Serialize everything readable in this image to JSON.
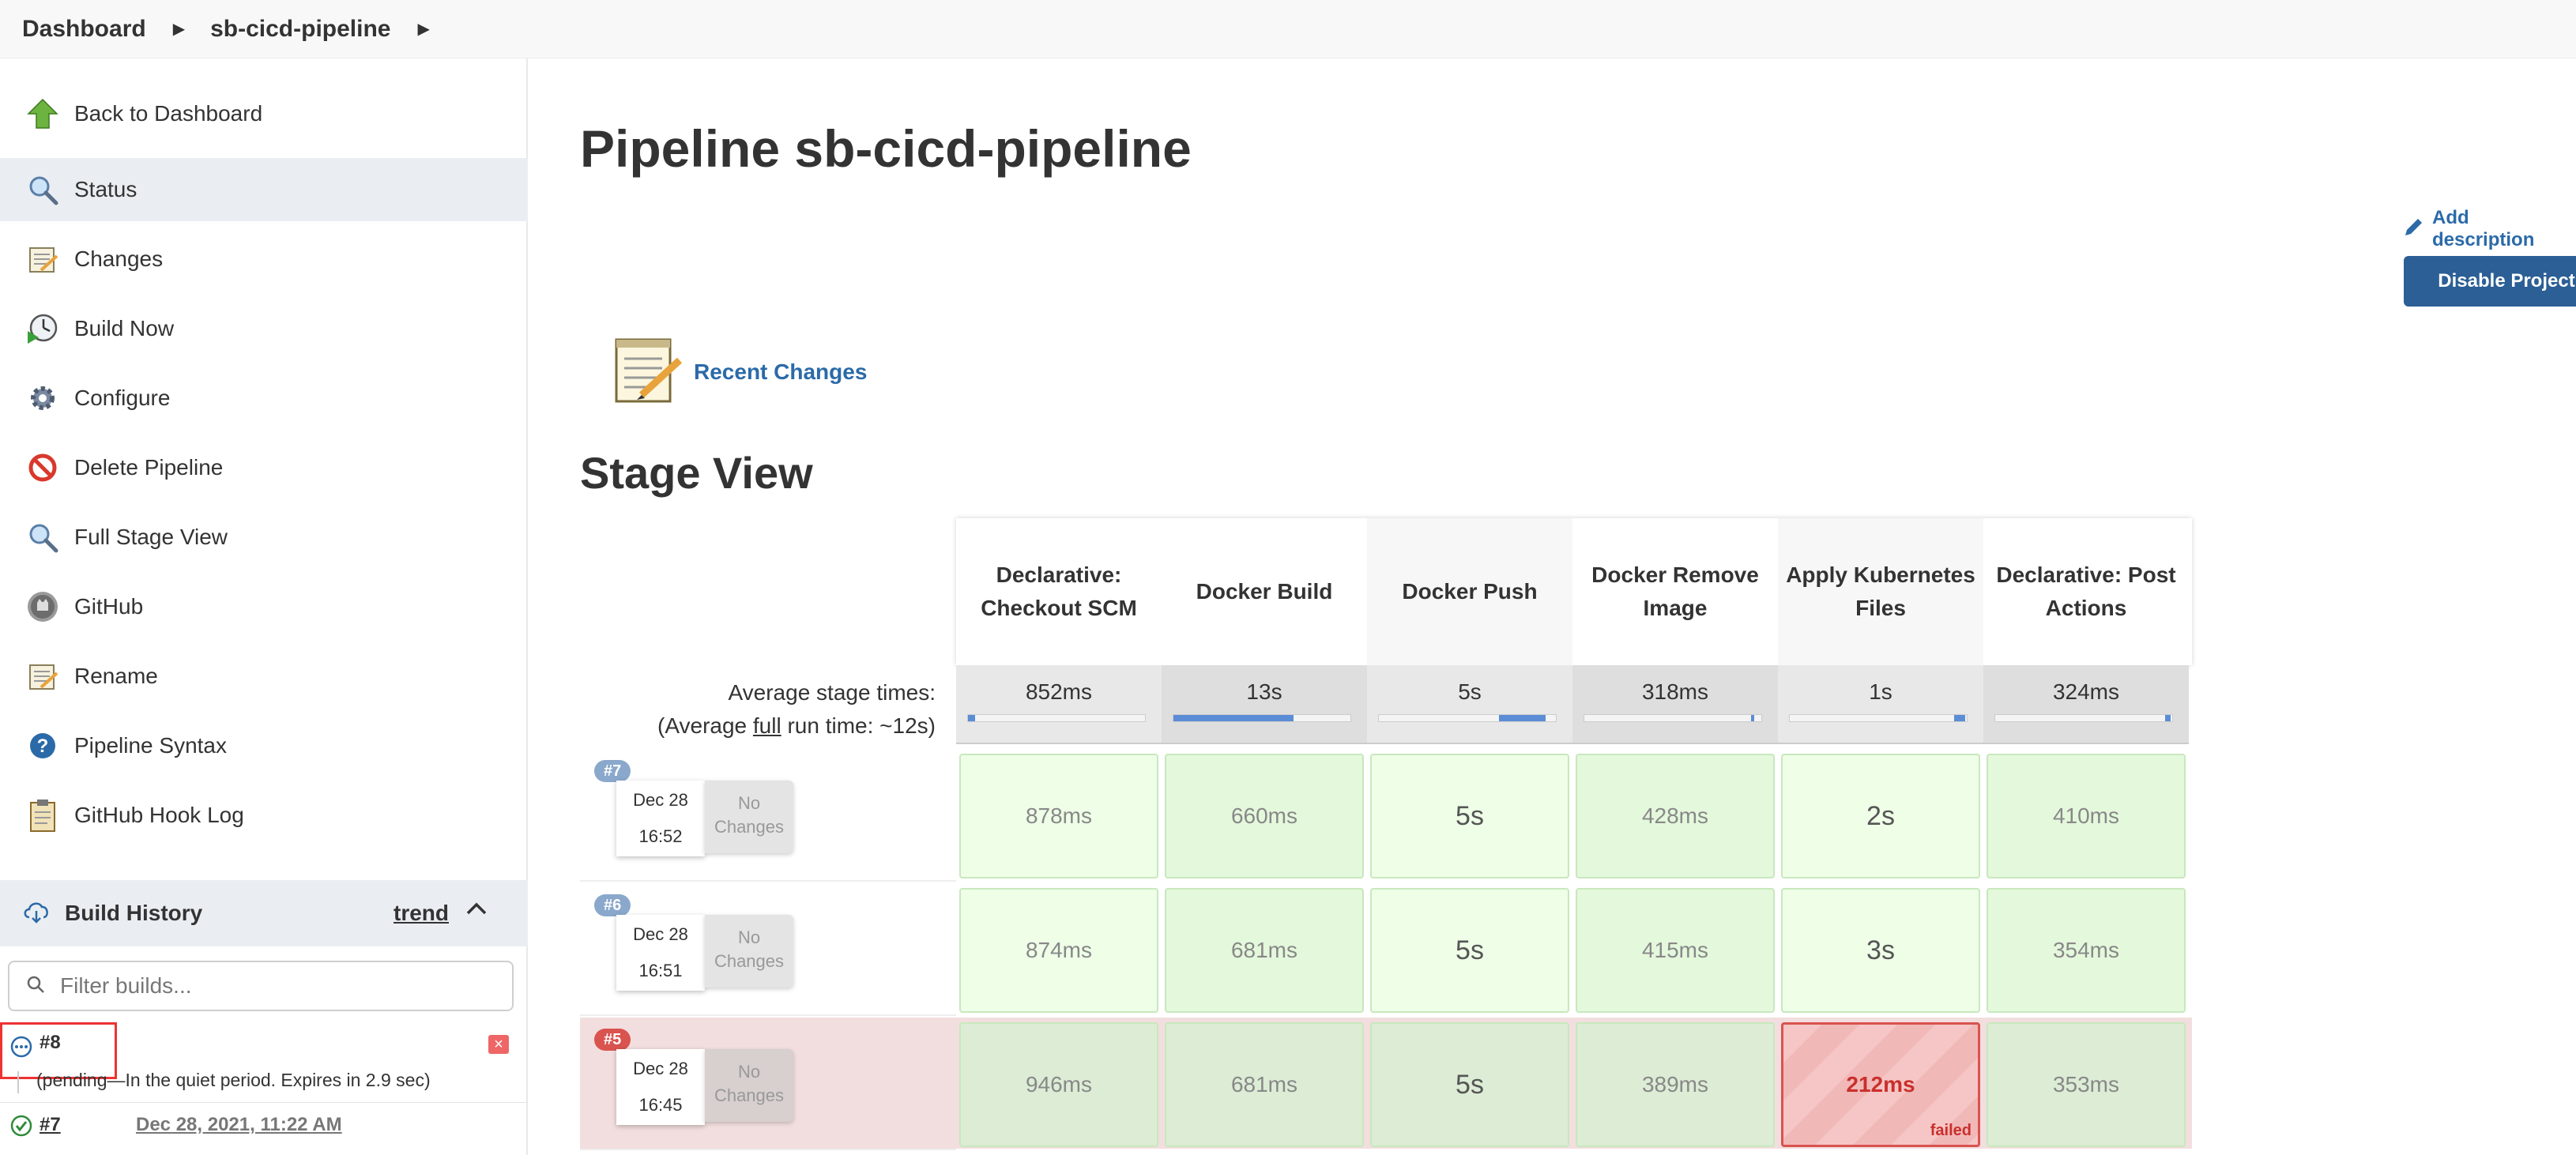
{
  "breadcrumb": {
    "items": [
      "Dashboard",
      "sb-cicd-pipeline"
    ]
  },
  "sidebar": {
    "items": [
      {
        "label": "Back to Dashboard",
        "icon": "up-arrow-icon"
      },
      {
        "label": "Status",
        "icon": "magnifier-icon",
        "active": true
      },
      {
        "label": "Changes",
        "icon": "notepad-icon"
      },
      {
        "label": "Build Now",
        "icon": "clock-play-icon"
      },
      {
        "label": "Configure",
        "icon": "gear-icon"
      },
      {
        "label": "Delete Pipeline",
        "icon": "no-entry-icon"
      },
      {
        "label": "Full Stage View",
        "icon": "magnifier-icon"
      },
      {
        "label": "GitHub",
        "icon": "github-icon"
      },
      {
        "label": "Rename",
        "icon": "notepad-icon"
      },
      {
        "label": "Pipeline Syntax",
        "icon": "help-icon"
      },
      {
        "label": "GitHub Hook Log",
        "icon": "clipboard-icon"
      }
    ],
    "build_history": {
      "title": "Build History",
      "trend": "trend",
      "filter_placeholder": "Filter builds...",
      "builds": [
        {
          "number": "#8",
          "status": "pending",
          "note": "(pending—In the quiet period. Expires in 2.9 sec)"
        },
        {
          "number": "#7",
          "status": "success",
          "date": "Dec 28, 2021, 11:22 AM"
        }
      ]
    }
  },
  "main": {
    "title": "Pipeline sb-cicd-pipeline",
    "add_description": "Add description",
    "disable_button": "Disable Project",
    "recent_changes": "Recent Changes",
    "stage_view_title": "Stage View"
  },
  "stage_view": {
    "avg_label_line1": "Average stage times:",
    "avg_label_prefix": "(Average ",
    "avg_label_link": "full",
    "avg_label_suffix": " run time: ~12s)",
    "stages": [
      {
        "name": "Declarative: Checkout SCM",
        "avg": "852ms",
        "bar_start": 0.0,
        "bar_fill": 0.04
      },
      {
        "name": "Docker Build",
        "avg": "13s",
        "bar_start": 0.0,
        "bar_fill": 0.68
      },
      {
        "name": "Docker Push",
        "avg": "5s",
        "bar_start": 0.68,
        "bar_fill": 0.26
      },
      {
        "name": "Docker Remove Image",
        "avg": "318ms",
        "bar_start": 0.94,
        "bar_fill": 0.02
      },
      {
        "name": "Apply Kubernetes Files",
        "avg": "1s",
        "bar_start": 0.93,
        "bar_fill": 0.06
      },
      {
        "name": "Declarative: Post Actions",
        "avg": "324ms",
        "bar_start": 0.96,
        "bar_fill": 0.03
      }
    ],
    "builds": [
      {
        "badge": "#7",
        "date": "Dec 28",
        "time": "16:52",
        "changes": "No Changes",
        "failed": false,
        "times": [
          "878ms",
          "660ms",
          "5s",
          "428ms",
          "2s",
          "410ms"
        ]
      },
      {
        "badge": "#6",
        "date": "Dec 28",
        "time": "16:51",
        "changes": "No Changes",
        "failed": false,
        "times": [
          "874ms",
          "681ms",
          "5s",
          "415ms",
          "3s",
          "354ms"
        ]
      },
      {
        "badge": "#5",
        "date": "Dec 28",
        "time": "16:45",
        "changes": "No Changes",
        "failed": true,
        "times": [
          "946ms",
          "681ms",
          "5s",
          "389ms",
          "212ms",
          "353ms"
        ],
        "failed_stage_index": 4,
        "failed_label": "failed"
      }
    ]
  },
  "colors": {
    "link": "#2b6aa8",
    "button": "#2b5f95",
    "success_cell": "#eefee7",
    "failed_cell": "#f6c6c6",
    "failed_border": "#d9534f"
  }
}
